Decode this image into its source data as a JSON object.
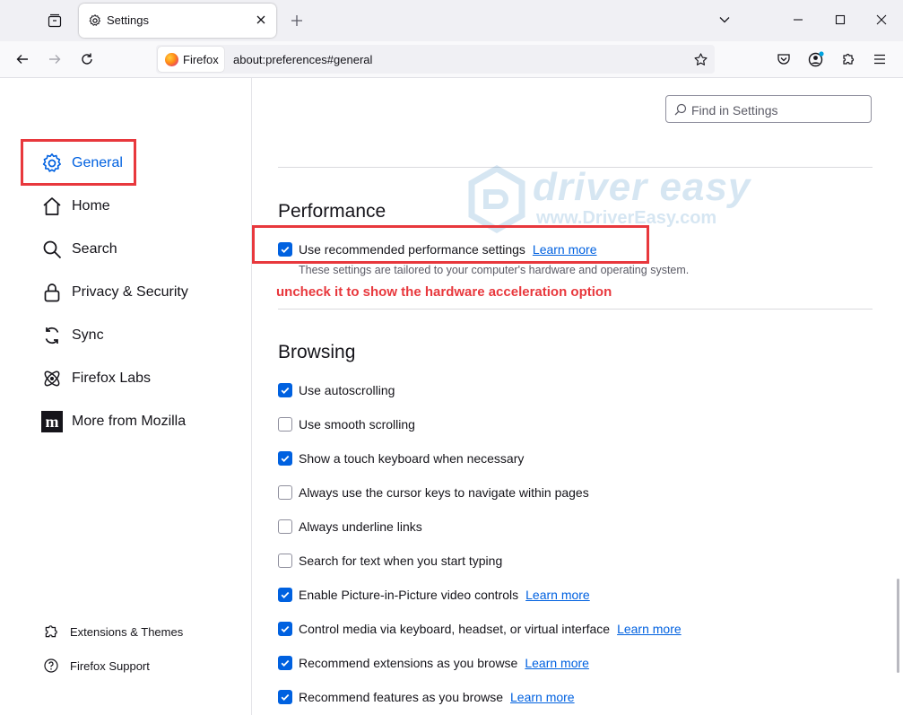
{
  "window": {
    "tab_title": "Settings"
  },
  "navbar": {
    "identity_label": "Firefox",
    "url": "about:preferences#general"
  },
  "sidebar": {
    "categories": [
      {
        "label": "General",
        "icon": "gear-icon",
        "selected": true
      },
      {
        "label": "Home",
        "icon": "home-icon"
      },
      {
        "label": "Search",
        "icon": "search-icon"
      },
      {
        "label": "Privacy & Security",
        "icon": "lock-icon"
      },
      {
        "label": "Sync",
        "icon": "sync-icon"
      },
      {
        "label": "Firefox Labs",
        "icon": "labs-icon"
      },
      {
        "label": "More from Mozilla",
        "icon": "mozilla-icon"
      }
    ],
    "footer_links": [
      {
        "label": "Extensions & Themes",
        "icon": "puzzle-icon"
      },
      {
        "label": "Firefox Support",
        "icon": "help-icon"
      }
    ]
  },
  "search": {
    "placeholder": "Find in Settings"
  },
  "performance": {
    "title": "Performance",
    "option_label": "Use recommended performance settings",
    "checked": true,
    "learn_more": "Learn more",
    "description": "These settings are tailored to your computer's hardware and operating system."
  },
  "annotation": {
    "note": "uncheck it to show the hardware acceleration option"
  },
  "watermark": {
    "brand": "driver easy",
    "url": "www.DriverEasy.com"
  },
  "browsing": {
    "title": "Browsing",
    "options": [
      {
        "label": "Use autoscrolling",
        "checked": true
      },
      {
        "label": "Use smooth scrolling",
        "checked": false
      },
      {
        "label": "Show a touch keyboard when necessary",
        "checked": true
      },
      {
        "label": "Always use the cursor keys to navigate within pages",
        "checked": false
      },
      {
        "label": "Always underline links",
        "checked": false
      },
      {
        "label": "Search for text when you start typing",
        "checked": false
      },
      {
        "label": "Enable Picture-in-Picture video controls",
        "checked": true,
        "learn_more": "Learn more"
      },
      {
        "label": "Control media via keyboard, headset, or virtual interface",
        "checked": true,
        "learn_more": "Learn more"
      },
      {
        "label": "Recommend extensions as you browse",
        "checked": true,
        "learn_more": "Learn more"
      },
      {
        "label": "Recommend features as you browse",
        "checked": true,
        "learn_more": "Learn more"
      }
    ]
  },
  "colors": {
    "accent": "#0061e0",
    "annotation": "#e8383d"
  }
}
